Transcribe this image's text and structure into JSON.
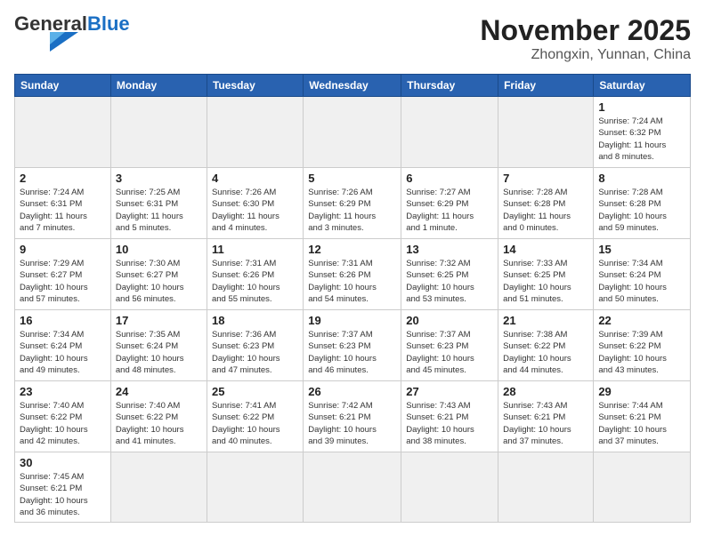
{
  "logo": {
    "general": "General",
    "blue": "Blue"
  },
  "header": {
    "month": "November 2025",
    "location": "Zhongxin, Yunnan, China"
  },
  "weekdays": [
    "Sunday",
    "Monday",
    "Tuesday",
    "Wednesday",
    "Thursday",
    "Friday",
    "Saturday"
  ],
  "weeks": [
    [
      {
        "day": "",
        "info": ""
      },
      {
        "day": "",
        "info": ""
      },
      {
        "day": "",
        "info": ""
      },
      {
        "day": "",
        "info": ""
      },
      {
        "day": "",
        "info": ""
      },
      {
        "day": "",
        "info": ""
      },
      {
        "day": "1",
        "info": "Sunrise: 7:24 AM\nSunset: 6:32 PM\nDaylight: 11 hours\nand 8 minutes."
      }
    ],
    [
      {
        "day": "2",
        "info": "Sunrise: 7:24 AM\nSunset: 6:31 PM\nDaylight: 11 hours\nand 7 minutes."
      },
      {
        "day": "3",
        "info": "Sunrise: 7:25 AM\nSunset: 6:31 PM\nDaylight: 11 hours\nand 5 minutes."
      },
      {
        "day": "4",
        "info": "Sunrise: 7:26 AM\nSunset: 6:30 PM\nDaylight: 11 hours\nand 4 minutes."
      },
      {
        "day": "5",
        "info": "Sunrise: 7:26 AM\nSunset: 6:29 PM\nDaylight: 11 hours\nand 3 minutes."
      },
      {
        "day": "6",
        "info": "Sunrise: 7:27 AM\nSunset: 6:29 PM\nDaylight: 11 hours\nand 1 minute."
      },
      {
        "day": "7",
        "info": "Sunrise: 7:28 AM\nSunset: 6:28 PM\nDaylight: 11 hours\nand 0 minutes."
      },
      {
        "day": "8",
        "info": "Sunrise: 7:28 AM\nSunset: 6:28 PM\nDaylight: 10 hours\nand 59 minutes."
      }
    ],
    [
      {
        "day": "9",
        "info": "Sunrise: 7:29 AM\nSunset: 6:27 PM\nDaylight: 10 hours\nand 57 minutes."
      },
      {
        "day": "10",
        "info": "Sunrise: 7:30 AM\nSunset: 6:27 PM\nDaylight: 10 hours\nand 56 minutes."
      },
      {
        "day": "11",
        "info": "Sunrise: 7:31 AM\nSunset: 6:26 PM\nDaylight: 10 hours\nand 55 minutes."
      },
      {
        "day": "12",
        "info": "Sunrise: 7:31 AM\nSunset: 6:26 PM\nDaylight: 10 hours\nand 54 minutes."
      },
      {
        "day": "13",
        "info": "Sunrise: 7:32 AM\nSunset: 6:25 PM\nDaylight: 10 hours\nand 53 minutes."
      },
      {
        "day": "14",
        "info": "Sunrise: 7:33 AM\nSunset: 6:25 PM\nDaylight: 10 hours\nand 51 minutes."
      },
      {
        "day": "15",
        "info": "Sunrise: 7:34 AM\nSunset: 6:24 PM\nDaylight: 10 hours\nand 50 minutes."
      }
    ],
    [
      {
        "day": "16",
        "info": "Sunrise: 7:34 AM\nSunset: 6:24 PM\nDaylight: 10 hours\nand 49 minutes."
      },
      {
        "day": "17",
        "info": "Sunrise: 7:35 AM\nSunset: 6:24 PM\nDaylight: 10 hours\nand 48 minutes."
      },
      {
        "day": "18",
        "info": "Sunrise: 7:36 AM\nSunset: 6:23 PM\nDaylight: 10 hours\nand 47 minutes."
      },
      {
        "day": "19",
        "info": "Sunrise: 7:37 AM\nSunset: 6:23 PM\nDaylight: 10 hours\nand 46 minutes."
      },
      {
        "day": "20",
        "info": "Sunrise: 7:37 AM\nSunset: 6:23 PM\nDaylight: 10 hours\nand 45 minutes."
      },
      {
        "day": "21",
        "info": "Sunrise: 7:38 AM\nSunset: 6:22 PM\nDaylight: 10 hours\nand 44 minutes."
      },
      {
        "day": "22",
        "info": "Sunrise: 7:39 AM\nSunset: 6:22 PM\nDaylight: 10 hours\nand 43 minutes."
      }
    ],
    [
      {
        "day": "23",
        "info": "Sunrise: 7:40 AM\nSunset: 6:22 PM\nDaylight: 10 hours\nand 42 minutes."
      },
      {
        "day": "24",
        "info": "Sunrise: 7:40 AM\nSunset: 6:22 PM\nDaylight: 10 hours\nand 41 minutes."
      },
      {
        "day": "25",
        "info": "Sunrise: 7:41 AM\nSunset: 6:22 PM\nDaylight: 10 hours\nand 40 minutes."
      },
      {
        "day": "26",
        "info": "Sunrise: 7:42 AM\nSunset: 6:21 PM\nDaylight: 10 hours\nand 39 minutes."
      },
      {
        "day": "27",
        "info": "Sunrise: 7:43 AM\nSunset: 6:21 PM\nDaylight: 10 hours\nand 38 minutes."
      },
      {
        "day": "28",
        "info": "Sunrise: 7:43 AM\nSunset: 6:21 PM\nDaylight: 10 hours\nand 37 minutes."
      },
      {
        "day": "29",
        "info": "Sunrise: 7:44 AM\nSunset: 6:21 PM\nDaylight: 10 hours\nand 37 minutes."
      }
    ],
    [
      {
        "day": "30",
        "info": "Sunrise: 7:45 AM\nSunset: 6:21 PM\nDaylight: 10 hours\nand 36 minutes."
      },
      {
        "day": "",
        "info": ""
      },
      {
        "day": "",
        "info": ""
      },
      {
        "day": "",
        "info": ""
      },
      {
        "day": "",
        "info": ""
      },
      {
        "day": "",
        "info": ""
      },
      {
        "day": "",
        "info": ""
      }
    ]
  ]
}
